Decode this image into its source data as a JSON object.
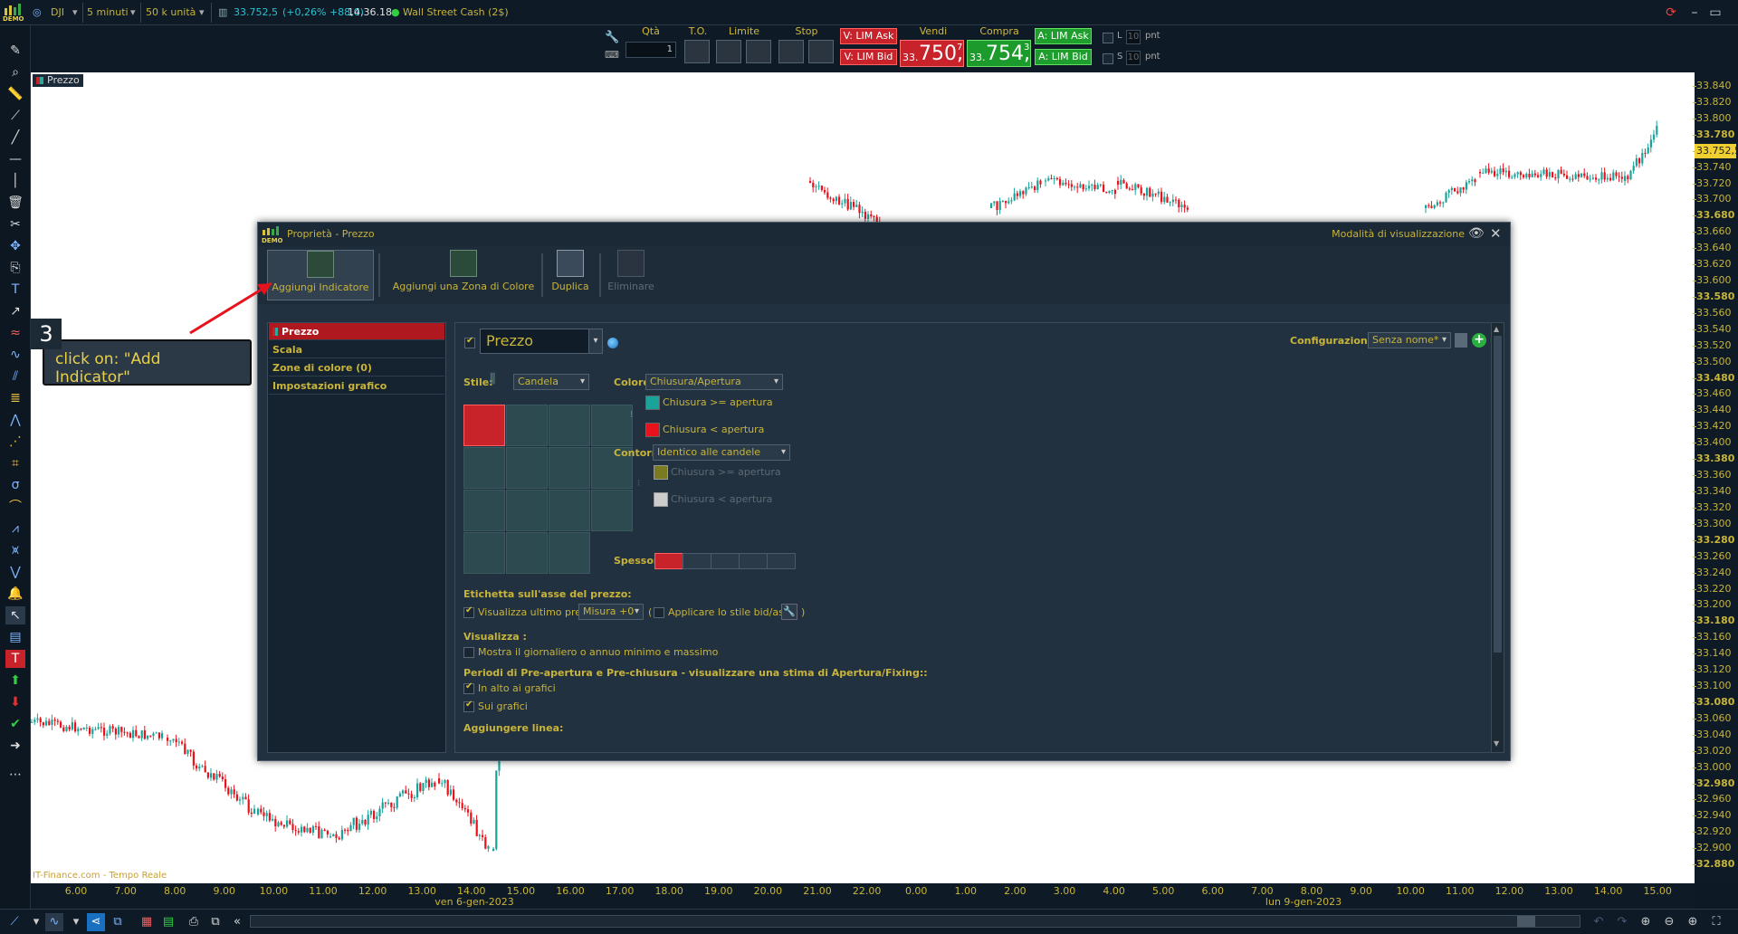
{
  "topbar": {
    "logo_text": "DEMO",
    "symbol": "DJI",
    "timeframe": "5 minuti",
    "units": "50 k unità",
    "quote_price": "33.752,5",
    "quote_change": "(+0,26% +88,0)",
    "quote_time": "14.36.18",
    "instrument": "Wall Street Cash (2$)"
  },
  "trade": {
    "qty_label": "Qtà",
    "qty_value": "1",
    "to_label": "T.O.",
    "limit_label": "Limite",
    "stop_label": "Stop",
    "v_lim_ask": "V: LIM Ask",
    "v_lim_bid": "V: LIM Bid",
    "sell_label": "Vendi",
    "buy_label": "Compra",
    "sell_small": "33.",
    "sell_big": "750,",
    "sell_sup": "7",
    "buy_small": "33.",
    "buy_big": "754,",
    "buy_sup": "3",
    "a_lim_ask": "A: LIM Ask",
    "a_lim_bid": "A: LIM Bid",
    "l_label": "L",
    "s_label": "S",
    "l_value": "10",
    "s_value": "10",
    "pnt": "pnt"
  },
  "chart": {
    "label": "Prezzo",
    "credit": "IT-Finance.com - Tempo Reale",
    "price_tag": "33.752,5",
    "y_ticks": [
      "33.840",
      "33.820",
      "33.800",
      "33.780",
      "33.760",
      "33.740",
      "33.720",
      "33.700",
      "33.680",
      "33.660",
      "33.640",
      "33.620",
      "33.600",
      "33.580",
      "33.560",
      "33.540",
      "33.520",
      "33.500",
      "33.480",
      "33.460",
      "33.440",
      "33.420",
      "33.400",
      "33.380",
      "33.360",
      "33.340",
      "33.320",
      "33.300",
      "33.280",
      "33.260",
      "33.240",
      "33.220",
      "33.200",
      "33.180",
      "33.160",
      "33.140",
      "33.120",
      "33.100",
      "33.080",
      "33.060",
      "33.040",
      "33.020",
      "33.000",
      "32.980",
      "32.960",
      "32.940",
      "32.920",
      "32.900",
      "32.880"
    ],
    "x_ticks": [
      "6.00",
      "7.00",
      "8.00",
      "9.00",
      "10.00",
      "11.00",
      "12.00",
      "13.00",
      "14.00",
      "15.00",
      "16.00",
      "17.00",
      "18.00",
      "19.00",
      "20.00",
      "21.00",
      "22.00",
      "0.00",
      "1.00",
      "2.00",
      "3.00",
      "4.00",
      "5.00",
      "6.00",
      "7.00",
      "8.00",
      "9.00",
      "10.00",
      "11.00",
      "12.00",
      "13.00",
      "14.00",
      "15.00"
    ],
    "date_left": "ven 6-gen-2023",
    "date_right": "lun 9-gen-2023"
  },
  "callout": {
    "step": "3",
    "text": "click on: \"Add Indicator\""
  },
  "dialog": {
    "title": "Proprietà - Prezzo",
    "mode": "Modalità di visualizzazione",
    "tools": {
      "add_indicator": "Aggiungi Indicatore",
      "add_zone": "Aggiungi una Zona di Colore",
      "duplicate": "Duplica",
      "delete": "Eliminare"
    },
    "nav": [
      "Prezzo",
      "Scala",
      "Zone di colore (0)",
      "Impostazioni grafico"
    ],
    "name_value": "Prezzo",
    "config_label": "Configurazione:",
    "config_value": "Senza nome*",
    "stile_label": "Stile:",
    "stile_value": "Candela",
    "colore_label": "Colore :",
    "colore_value": "Chiusura/Apertura",
    "up_label": "Chiusura >= apertura",
    "down_label": "Chiusura < apertura",
    "contorno_label": "Contorno:",
    "contorno_value": "Identico alle candele",
    "outline_up": "Chiusura >= apertura",
    "outline_down": "Chiusura < apertura",
    "spessore_label": "Spessore :",
    "etichetta_label": "Etichetta sull'asse del prezzo:",
    "last_price_label": "Visualizza ultimo prezzo",
    "misura_value": "Misura +0",
    "open_paren": "(",
    "bidask_label": "Applicare lo stile bid/ask",
    "close_paren": ")",
    "visualizza_label": "Visualizza :",
    "minmax_label": "Mostra il giornaliero o annuo minimo e massimo",
    "periods_label": "Periodi di Pre-apertura e Pre-chiusura - visualizzare una stima di Apertura/Fixing::",
    "top_label": "In alto ai grafici",
    "on_label": "Sui grafici",
    "add_line_label": "Aggiungere linea:"
  },
  "colors": {
    "up": "#1aa39a",
    "down": "#e8121c",
    "accent": "#c8b43a"
  }
}
